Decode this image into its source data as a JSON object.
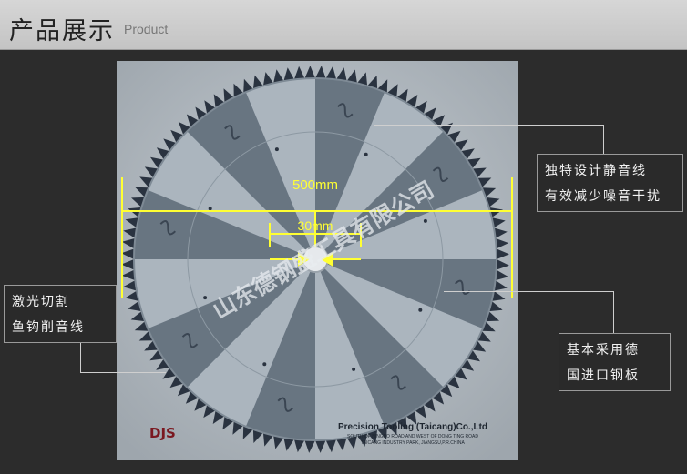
{
  "header": {
    "title": "产品展示",
    "subtitle": "Product"
  },
  "product_image": {
    "dimension_outer": "500mm",
    "dimension_bore": "30mm",
    "watermark": "山东德钢盛工具有限公司",
    "company_line": "Precision Tooling (Taicang)Co.,Ltd",
    "address_line_1": "SOUTH OF NINGBO ROAD AND WEST OF DONG TING ROAD",
    "address_line_2": "TAICANG INDUSTRY PARK, JIANGSU,P.R.CHINA",
    "logo_text": "DJS"
  },
  "callouts": {
    "noise": {
      "line1": "独特设计静音线",
      "line2": "有效减少噪音干扰"
    },
    "laser": {
      "line1": "激光切割",
      "line2": "鱼钩削音线"
    },
    "steel": {
      "line1": "基本采用德",
      "line2": "国进口钢板"
    }
  },
  "colors": {
    "dimension": "#ffff33",
    "header_bg": "#cdcdcd",
    "page_bg": "#2c2c2c"
  }
}
